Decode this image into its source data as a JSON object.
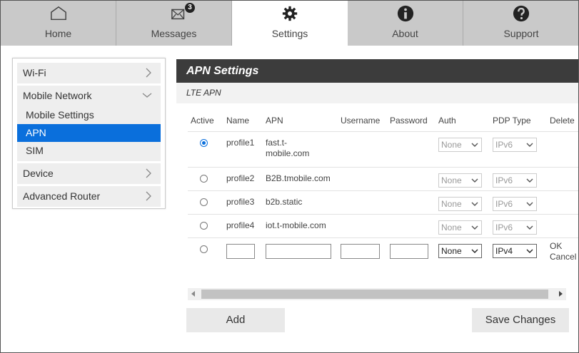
{
  "nav": {
    "tabs": [
      {
        "label": "Home",
        "icon": "home-icon"
      },
      {
        "label": "Messages",
        "icon": "envelope-icon",
        "badge": "3"
      },
      {
        "label": "Settings",
        "icon": "gear-icon",
        "active": true
      },
      {
        "label": "About",
        "icon": "info-icon"
      },
      {
        "label": "Support",
        "icon": "question-icon"
      }
    ]
  },
  "sidebar": {
    "wifi": "Wi-Fi",
    "mobile_network": "Mobile Network",
    "sub": {
      "mobile_settings": "Mobile Settings",
      "apn": "APN",
      "sim": "SIM"
    },
    "device": "Device",
    "advanced_router": "Advanced Router"
  },
  "main": {
    "title": "APN Settings",
    "subtitle": "LTE APN",
    "headers": {
      "active": "Active",
      "name": "Name",
      "apn": "APN",
      "username": "Username",
      "password": "Password",
      "auth": "Auth",
      "pdp_type": "PDP Type",
      "delete": "Delete"
    },
    "rows": [
      {
        "name": "profile1",
        "apn_line1": "fast.t-",
        "apn_line2": "mobile.com",
        "auth": "None",
        "pdp": "IPv6",
        "selected": true
      },
      {
        "name": "profile2",
        "apn": "B2B.tmobile.com",
        "auth": "None",
        "pdp": "IPv6"
      },
      {
        "name": "profile3",
        "apn": "b2b.static",
        "auth": "None",
        "pdp": "IPv6"
      },
      {
        "name": "profile4",
        "apn": "iot.t-mobile.com",
        "auth": "None",
        "pdp": "IPv6"
      }
    ],
    "new_row": {
      "auth": "None",
      "pdp": "IPv4",
      "ok": "OK",
      "cancel": "Cancel"
    },
    "add_label": "Add",
    "save_label": "Save Changes"
  },
  "colors": {
    "accent": "#0a6fdc",
    "header_bg": "#3c3c3c",
    "nav_bg": "#c9c9c9"
  }
}
